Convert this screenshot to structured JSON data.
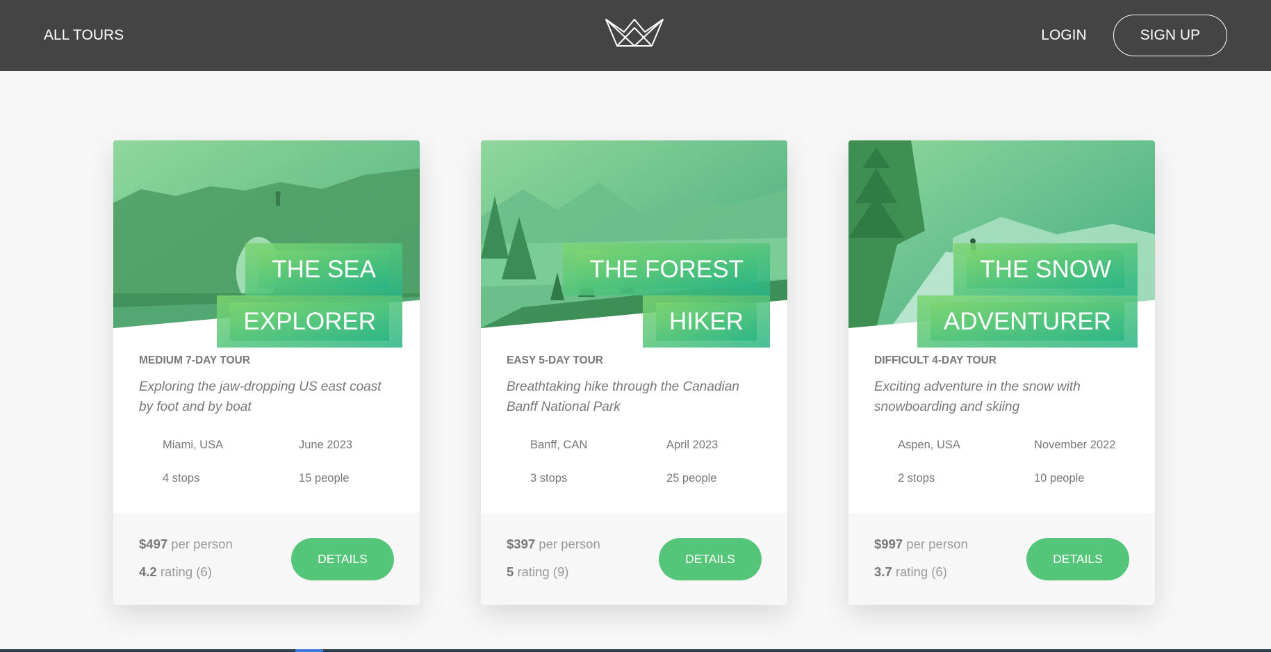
{
  "header": {
    "all_tours": "ALL TOURS",
    "login": "LOGIN",
    "signup": "SIGN UP",
    "logo_icon": "crown-logo-icon"
  },
  "colors": {
    "header_bg": "#444444",
    "accent_green": "#55c57a",
    "page_bg": "#f7f7f7"
  },
  "cards": [
    {
      "title_line1": "THE SEA",
      "title_line2": "EXPLORER",
      "sub_heading": "MEDIUM 7-DAY TOUR",
      "summary": "Exploring the jaw-dropping US east coast by foot and by boat",
      "location": "Miami, USA",
      "date": "June 2023",
      "stops": "4 stops",
      "people": "15 people",
      "price": "$497",
      "price_suffix": "per person",
      "rating": "4.2",
      "rating_suffix": "rating (6)",
      "button": "DETAILS"
    },
    {
      "title_line1": "THE FOREST",
      "title_line2": "HIKER",
      "sub_heading": "EASY 5-DAY TOUR",
      "summary": "Breathtaking hike through the Canadian Banff National Park",
      "location": "Banff, CAN",
      "date": "April 2023",
      "stops": "3 stops",
      "people": "25 people",
      "price": "$397",
      "price_suffix": "per person",
      "rating": "5",
      "rating_suffix": "rating (9)",
      "button": "DETAILS"
    },
    {
      "title_line1": "THE SNOW",
      "title_line2": "ADVENTURER",
      "sub_heading": "DIFFICULT 4-DAY TOUR",
      "summary": "Exciting adventure in the snow with snowboarding and skiing",
      "location": "Aspen, USA",
      "date": "November 2022",
      "stops": "2 stops",
      "people": "10 people",
      "price": "$997",
      "price_suffix": "per person",
      "rating": "3.7",
      "rating_suffix": "rating (6)",
      "button": "DETAILS"
    }
  ]
}
